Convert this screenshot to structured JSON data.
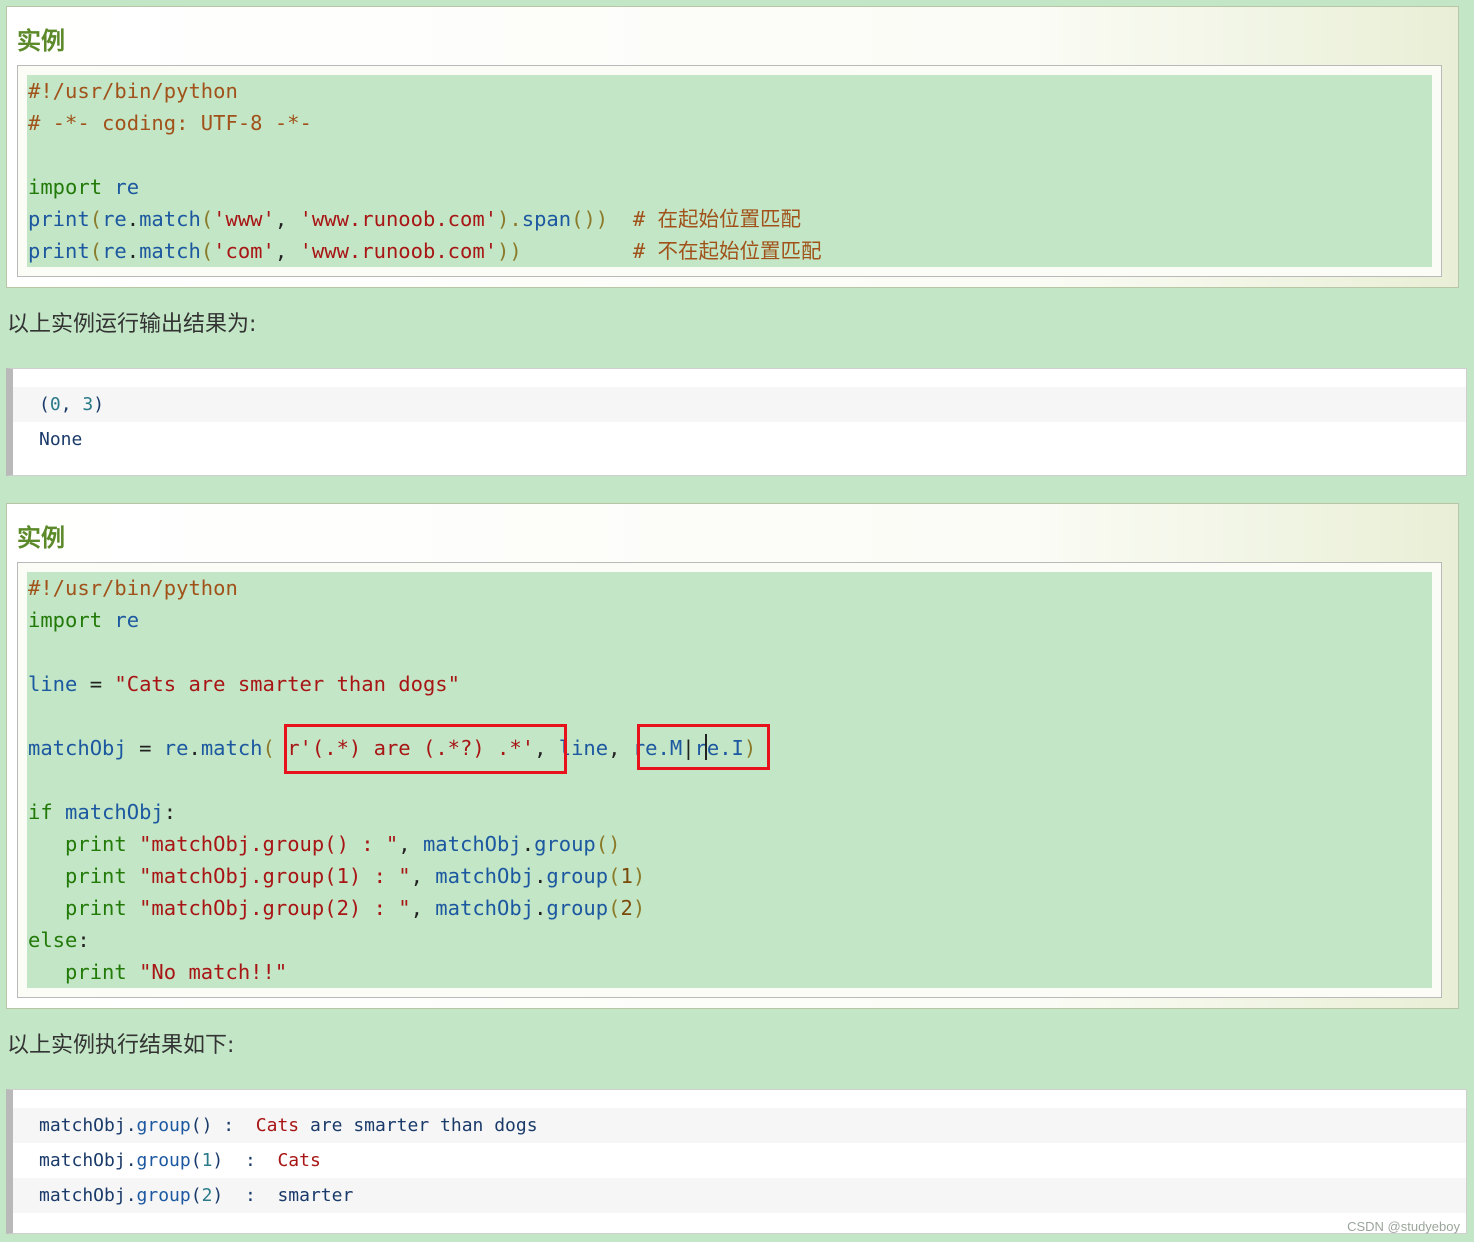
{
  "example1": {
    "title": "实例",
    "code": {
      "l1": "#!/usr/bin/python",
      "l2": "# -*- coding: UTF-8 -*-",
      "l3_kw": "import",
      "l3_mod": " re",
      "l4_a": "print",
      "l4_b": "(",
      "l4_c": "re",
      "l4_d": ".",
      "l4_e": "match",
      "l4_f": "(",
      "l4_g": "'www'",
      "l4_h": ", ",
      "l4_i": "'www.runoob.com'",
      "l4_j": ").",
      "l4_k": "span",
      "l4_l": "())",
      "l4_cm": "  # ",
      "l4_cj": "在起始位置匹配",
      "l5_a": "print",
      "l5_b": "(",
      "l5_c": "re",
      "l5_d": ".",
      "l5_e": "match",
      "l5_f": "(",
      "l5_g": "'com'",
      "l5_h": ", ",
      "l5_i": "'www.runoob.com'",
      "l5_j": "))",
      "l5_cm": "         # ",
      "l5_cj": "不在起始位置匹配"
    }
  },
  "para1": "以上实例运行输出结果为:",
  "output1": {
    "line1_open": "(",
    "line1_a": "0",
    "line1_sep": ", ",
    "line1_b": "3",
    "line1_close": ")",
    "line2": "None"
  },
  "example2": {
    "title": "实例",
    "code": {
      "l1": "#!/usr/bin/python",
      "l2_kw": "import",
      "l2_mod": " re",
      "l3_var": "line",
      "l3_eq": " = ",
      "l3_str": "\"Cats are smarter than dogs\"",
      "l4_var": "matchObj",
      "l4_eq": " = ",
      "l4_re": "re",
      "l4_dot": ".",
      "l4_fn": "match",
      "l4_paren": "( ",
      "l4_pat": "r'(.*) are (.*?) .*'",
      "l4_comma": ",",
      "l4_line": " line",
      "l4_comma2": ", ",
      "l4_flag1": "re.M",
      "l4_pipe": "|",
      "l4_flag2": "re.I",
      "l4_close": ")",
      "l5_kw": "if",
      "l5_var": " matchObj",
      "l5_colon": ":",
      "l6_kw": "   print",
      "l6_str": " \"matchObj.group() : \"",
      "l6_comma": ",",
      "l6_obj": " matchObj",
      "l6_dot": ".",
      "l6_fn": "group",
      "l6_args": "()",
      "l7_kw": "   print",
      "l7_str": " \"matchObj.group(1) : \"",
      "l7_comma": ",",
      "l7_obj": " matchObj",
      "l7_dot": ".",
      "l7_fn": "group",
      "l7_p1": "(",
      "l7_n": "1",
      "l7_p2": ")",
      "l8_kw": "   print",
      "l8_str": " \"matchObj.group(2) : \"",
      "l8_comma": ",",
      "l8_obj": " matchObj",
      "l8_dot": ".",
      "l8_fn": "group",
      "l8_p1": "(",
      "l8_n": "2",
      "l8_p2": ")",
      "l9_kw": "else",
      "l9_colon": ":",
      "l10_kw": "   print",
      "l10_str": " \"No match!!\""
    }
  },
  "para2": "以上实例执行结果如下:",
  "output2": {
    "r1_obj": "matchObj",
    "r1_dot": ".",
    "r1_fn": "group",
    "r1_args": "()",
    "r1_sep": " :  ",
    "r1_w1": "Cats",
    "r1_rest": " are smarter than dogs",
    "r2_obj": "matchObj",
    "r2_dot": ".",
    "r2_fn": "group",
    "r2_p1": "(",
    "r2_n": "1",
    "r2_p2": ")",
    "r2_sep": "  :  ",
    "r2_w1": "Cats",
    "r3_obj": "matchObj",
    "r3_dot": ".",
    "r3_fn": "group",
    "r3_p1": "(",
    "r3_n": "2",
    "r3_p2": ")",
    "r3_sep": "  :  ",
    "r3_w1": "smarter"
  },
  "watermark": "CSDN @studyeboy",
  "colors": {
    "highlight": "#e8121c",
    "page_bg": "#c3e6c6",
    "title": "#5c8a2a"
  }
}
